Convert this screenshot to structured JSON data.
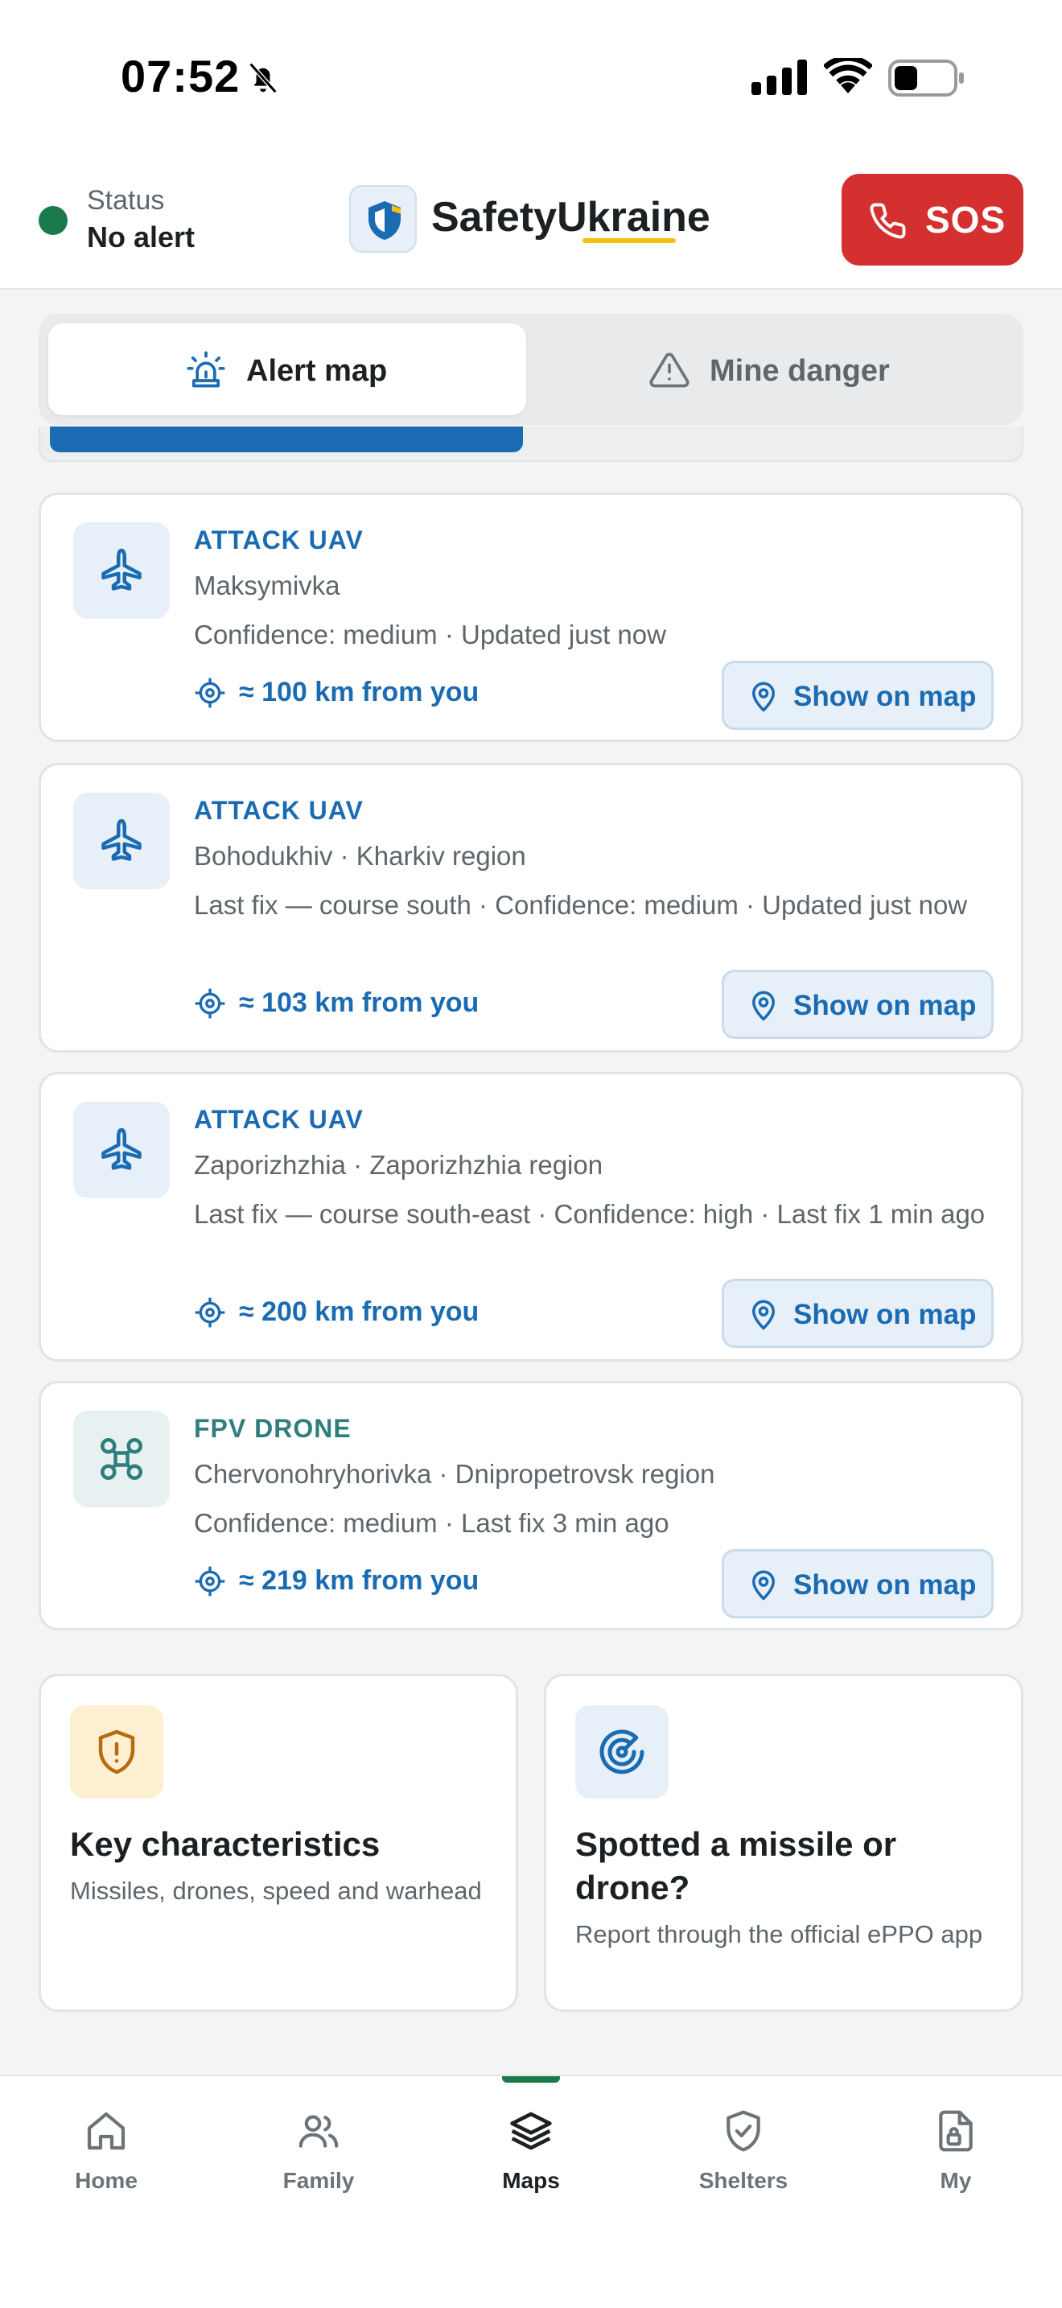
{
  "status_bar": {
    "time": "07:52"
  },
  "header": {
    "status_label": "Status",
    "status_value": "No alert",
    "brand_part1": "Safety",
    "brand_part2": "Ukraine",
    "sos_label": "SOS",
    "colors": {
      "status_dot": "#1a7a4c",
      "sos": "#d3302f",
      "accent": "#1b6bb3",
      "underline": "#f4c20d"
    }
  },
  "tabs": [
    {
      "label": "Alert map",
      "icon": "siren-icon",
      "active": true
    },
    {
      "label": "Mine danger",
      "icon": "warning-icon",
      "active": false
    }
  ],
  "progress": {
    "fraction": 0.49
  },
  "threats": [
    {
      "type": "ATTACK UAV",
      "icon": "plane-icon",
      "place": "Maksymivka",
      "meta": "Confidence: medium · Updated just now",
      "distance": "≈ 100 km from you",
      "action": "Show on map"
    },
    {
      "type": "ATTACK UAV",
      "icon": "plane-icon",
      "place": "Bohodukhiv · Kharkiv region",
      "meta": "Last fix — course south · Confidence: medium · Updated just now",
      "distance": "≈ 103 km from you",
      "action": "Show on map"
    },
    {
      "type": "ATTACK UAV",
      "icon": "plane-icon",
      "place": "Zaporizhzhia · Zaporizhzhia region",
      "meta": "Last fix — course south-east · Confidence: high · Last fix 1 min ago",
      "distance": "≈ 200 km from you",
      "action": "Show on map"
    },
    {
      "type": "FPV DRONE",
      "icon": "drone-icon",
      "place": "Chervonohryhorivka · Dnipropetrovsk region",
      "meta": "Confidence: medium · Last fix 3 min ago",
      "distance": "≈ 219 km from you",
      "action": "Show on map"
    }
  ],
  "tiles": [
    {
      "icon": "shield-alert-icon",
      "title": "Key characteristics",
      "subtitle": "Missiles, drones, speed and warhead"
    },
    {
      "icon": "radar-icon",
      "title": "Spotted a missile or drone?",
      "subtitle": "Report through the official ePPO app"
    }
  ],
  "nav": [
    {
      "label": "Home",
      "icon": "home-icon",
      "active": false
    },
    {
      "label": "Family",
      "icon": "family-icon",
      "active": false
    },
    {
      "label": "Maps",
      "icon": "layers-icon",
      "active": true
    },
    {
      "label": "Shelters",
      "icon": "shield-check-icon",
      "active": false
    },
    {
      "label": "My",
      "icon": "document-lock-icon",
      "active": false
    }
  ]
}
